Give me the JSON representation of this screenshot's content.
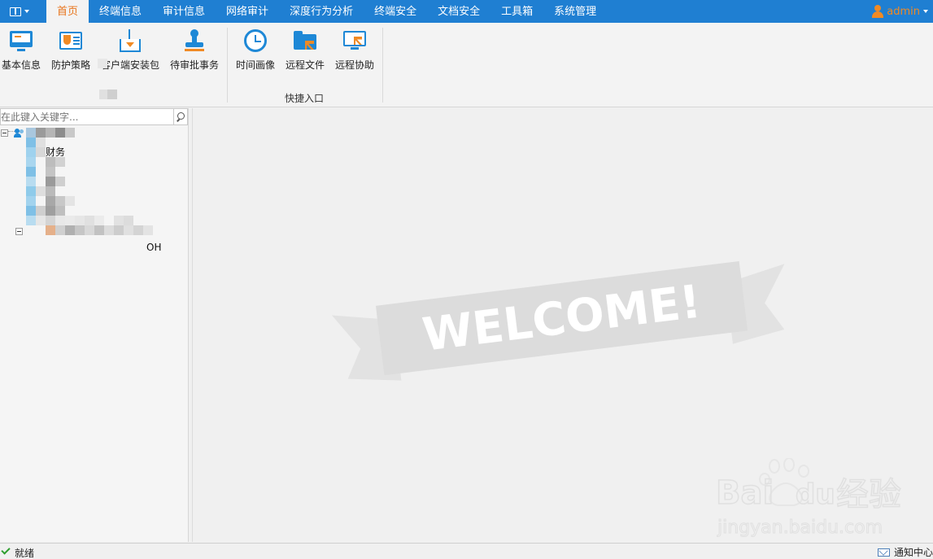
{
  "menubar": {
    "tabs": [
      {
        "label": "首页",
        "active": true
      },
      {
        "label": "终端信息"
      },
      {
        "label": "审计信息"
      },
      {
        "label": "网络审计"
      },
      {
        "label": "深度行为分析"
      },
      {
        "label": "终端安全"
      },
      {
        "label": "文档安全"
      },
      {
        "label": "工具箱"
      },
      {
        "label": "系统管理"
      }
    ],
    "user": {
      "name": "admin",
      "icon": "user-icon"
    },
    "colors": {
      "bar": "#1f7fd2",
      "active_text": "#e8741c",
      "user": "#f08a24"
    }
  },
  "ribbon": {
    "buttons": [
      {
        "label": "基本信息",
        "icon": "monitor-info-icon"
      },
      {
        "label": "防护策略",
        "icon": "shield-card-icon"
      },
      {
        "label": "客户端安装包",
        "icon": "package-icon"
      },
      {
        "label": "待审批事务",
        "icon": "stamp-icon"
      },
      {
        "label": "时间画像",
        "icon": "clock-icon"
      },
      {
        "label": "远程文件",
        "icon": "remote-folder-icon"
      },
      {
        "label": "远程协助",
        "icon": "remote-assist-icon"
      }
    ],
    "groups": [
      {
        "label": "快捷入口"
      }
    ]
  },
  "left_panel": {
    "search": {
      "placeholder": "在此键入关键字..."
    },
    "tree": {
      "nodes": [
        "财务",
        "OH"
      ]
    }
  },
  "main": {
    "welcome_text": "WELCOME!"
  },
  "statusbar": {
    "status": "就绪",
    "notify_label": "通知中心"
  },
  "watermark": {
    "brand_a": "Bai",
    "brand_b": "du",
    "brand_cn": "经验",
    "url": "jingyan.baidu.com"
  }
}
